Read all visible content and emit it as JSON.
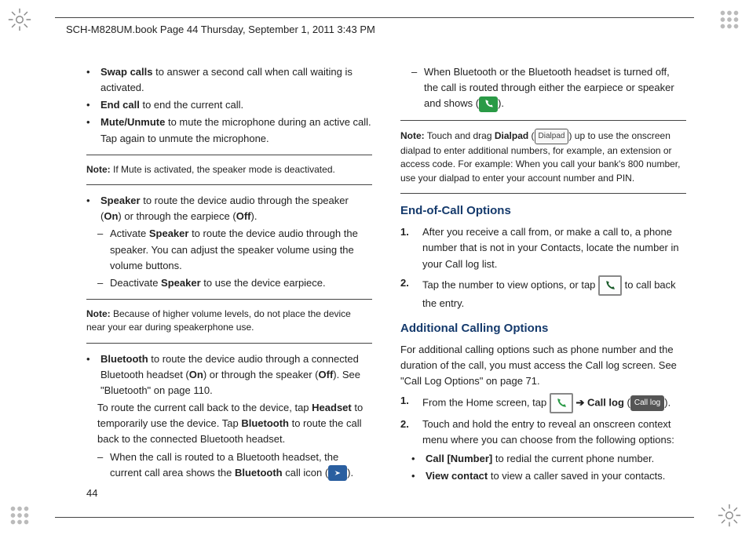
{
  "header": "SCH-M828UM.book  Page 44  Thursday, September 1, 2011  3:43 PM",
  "page_number": "44",
  "left": {
    "swap_b": "Swap calls",
    "swap_t": " to answer a second call when call waiting is activated.",
    "end_b": "End call",
    "end_t": " to end the current call.",
    "mute_b": "Mute/Unmute",
    "mute_t": " to mute the microphone during an active call. Tap again to unmute the microphone.",
    "note1_b": "Note:",
    "note1_t": " If Mute is activated, the speaker mode is deactivated.",
    "spk_b": "Speaker",
    "spk_t1": " to route the device audio through the speaker (",
    "spk_on": "On",
    "spk_t2": ") or through the earpiece (",
    "spk_off": "Off",
    "spk_t3": ").",
    "spk_a1": "Activate ",
    "spk_a1b": "Speaker",
    "spk_a1t": " to route the device audio through the speaker. You can adjust the speaker volume using the volume buttons.",
    "spk_d1": "Deactivate ",
    "spk_d1b": "Speaker",
    "spk_d1t": " to use the device earpiece.",
    "note2_b": "Note:",
    "note2_t": " Because of higher volume levels, do not place the device near your ear during speakerphone use.",
    "bt_b": "Bluetooth",
    "bt_t1": " to route the device audio through a connected Bluetooth headset (",
    "bt_on": "On",
    "bt_t2": ") or through the speaker (",
    "bt_off": "Off",
    "bt_t3": "). See \"Bluetooth\" on page 110.",
    "bt_p2a": "To route the current call back to the device, tap ",
    "bt_p2b": "Headset",
    "bt_p2c": " to temporarily use the device. Tap ",
    "bt_p2d": "Bluetooth",
    "bt_p2e": " to route the call back to the connected Bluetooth headset.",
    "bt_d1a": "When the call is routed to a Bluetooth headset, the current call area shows the ",
    "bt_d1b": "Bluetooth",
    "bt_d1c": " call icon (",
    "bt_d1d": ")."
  },
  "right": {
    "bt_d2a": "When Bluetooth or the Bluetooth headset is turned off, the call is routed through either the earpiece or speaker and shows (",
    "bt_d2b": ").",
    "note3_b": "Note:",
    "note3_t1": " Touch and drag ",
    "note3_t1b": "Dialpad",
    "note3_t2": " (",
    "note3_badge": "Dialpad",
    "note3_t3": ") up to use the onscreen dialpad to enter additional numbers, for example, an extension or access code. For example: When you call your bank's 800 number, use your dialpad to enter your account number and PIN.",
    "h_eoc": "End-of-Call Options",
    "eoc1": "After you receive a call from, or make a call to, a phone number that is not in your Contacts, locate the number in your Call log list.",
    "eoc2a": "Tap the number to view options, or tap ",
    "eoc2b": " to call back the entry.",
    "h_aco": "Additional Calling Options",
    "aco_p": "For additional calling options such as phone number and the duration of the call, you must access the Call log screen. See \"Call Log Options\" on page 71.",
    "aco1a": "From the Home screen, tap ",
    "aco1b": "  ➔ ",
    "aco1c": "Call log",
    "aco1d": " (",
    "aco1_badge": "Call log",
    "aco1e": ").",
    "aco2": "Touch and hold the entry to reveal an onscreen context menu where you can choose from the following options:",
    "aco_b1b": "Call [Number]",
    "aco_b1t": " to redial the current phone number.",
    "aco_b2b": "View contact",
    "aco_b2t": " to view a caller saved in your contacts."
  },
  "nums": {
    "n1": "1.",
    "n2": "2."
  },
  "glyph": {
    "bullet": "•",
    "dash": "–"
  }
}
